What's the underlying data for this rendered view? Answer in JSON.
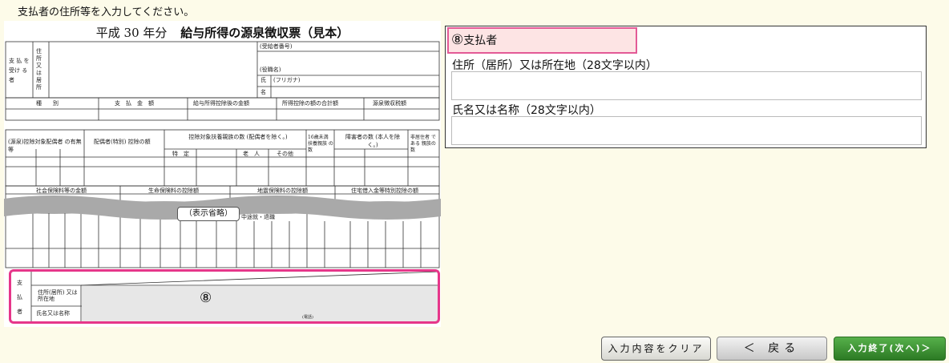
{
  "instruction": "支払者の住所等を入力してください。",
  "sample": {
    "title_year": "平成 30 年分",
    "title_main": "給与所得の源泉徴収票（見本）",
    "omit_label": "（表示省略）",
    "marker": "⑧",
    "labels": {
      "recipient": "支 払 を受け る 者",
      "address": "住所又は居所",
      "jukyu_no": "(受給者番号)",
      "yakushoku": "(役職名)",
      "furigana": "(フリガナ)",
      "shi": "氏",
      "mei": "名",
      "shubetsu": "種　　別",
      "shiharai_kingaku": "支　払　金　額",
      "kyuyo_shotoku": "給与所得控除後の金額",
      "shotoku_kojo": "所得控除の額の合計額",
      "gensen_choshu": "源泉徴収税額",
      "hai_guusha": "(源泉)控除対象配偶者 の有無等",
      "hai_kojo": "配偶者(特別) 控除の額",
      "fuyo_shinzoku": "控除対象扶養親族の数 (配偶者を除く。)",
      "under16": "16歳未満 扶養親族 の数",
      "shogaisha": "障害者の数 (本人を除く。)",
      "hikyojusha": "非居住者 である 親族の数",
      "tokutei": "特　定",
      "rojin": "老　人",
      "sonota": "その他",
      "shakai_hoken": "社会保険料等の金額",
      "seimei_hoken": "生命保険料の控除額",
      "jishin_hoken": "地震保険料の控除額",
      "jutaku": "住宅借入金等特別控除の額",
      "nakatoshi": "中途就・退職",
      "payer_side": "支 払 者",
      "payer_address": "住所(居所) 又は所在地",
      "payer_name": "氏名又は名称",
      "phone": "(電話)"
    }
  },
  "panel": {
    "header": "支払者",
    "header_marker": "⑧",
    "address_label": "住所（居所）又は所在地（28文字以内）",
    "address_value": "",
    "name_label": "氏名又は名称（28文字以内）",
    "name_value": ""
  },
  "buttons": {
    "clear": "入力内容をクリア",
    "back": "＜ 戻る",
    "next": "入力終了(次へ)＞"
  },
  "colors": {
    "background": "#fdfbe9",
    "highlight_border": "#e35a96",
    "highlight_fill": "#fde4e4",
    "next_button": "#3a8e30"
  }
}
